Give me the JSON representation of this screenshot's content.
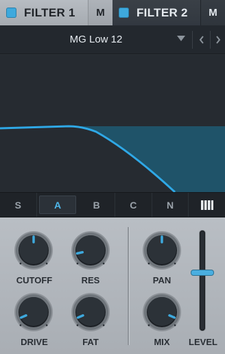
{
  "tabs": [
    {
      "label": "FILTER 1",
      "m_label": "M",
      "enabled": true
    },
    {
      "label": "FILTER 2",
      "m_label": "M",
      "enabled": true
    }
  ],
  "preset": {
    "name": "MG Low 12"
  },
  "filter_graph": {
    "curve": "lowpass",
    "fill_color": "#1f5a73",
    "line_color": "#2fa8e6"
  },
  "modes": [
    {
      "label": "S",
      "active": false
    },
    {
      "label": "A",
      "active": true
    },
    {
      "label": "B",
      "active": false
    },
    {
      "label": "C",
      "active": false
    },
    {
      "label": "N",
      "active": false
    },
    {
      "label": "",
      "icon": "piano-keys-icon",
      "active": false
    }
  ],
  "knobs": {
    "cutoff": {
      "label": "CUTOFF",
      "value": 0.5
    },
    "res": {
      "label": "RES",
      "value": 0.12
    },
    "drive": {
      "label": "DRIVE",
      "value": 0.08
    },
    "fat": {
      "label": "FAT",
      "value": 0.08
    },
    "pan": {
      "label": "PAN",
      "value": 0.5
    },
    "mix": {
      "label": "MIX",
      "value": 0.92
    }
  },
  "level": {
    "label": "LEVEL",
    "value": 0.5
  },
  "colors": {
    "accent": "#3ea9dd",
    "panel": "#b3b8be",
    "dark": "#23282e"
  }
}
